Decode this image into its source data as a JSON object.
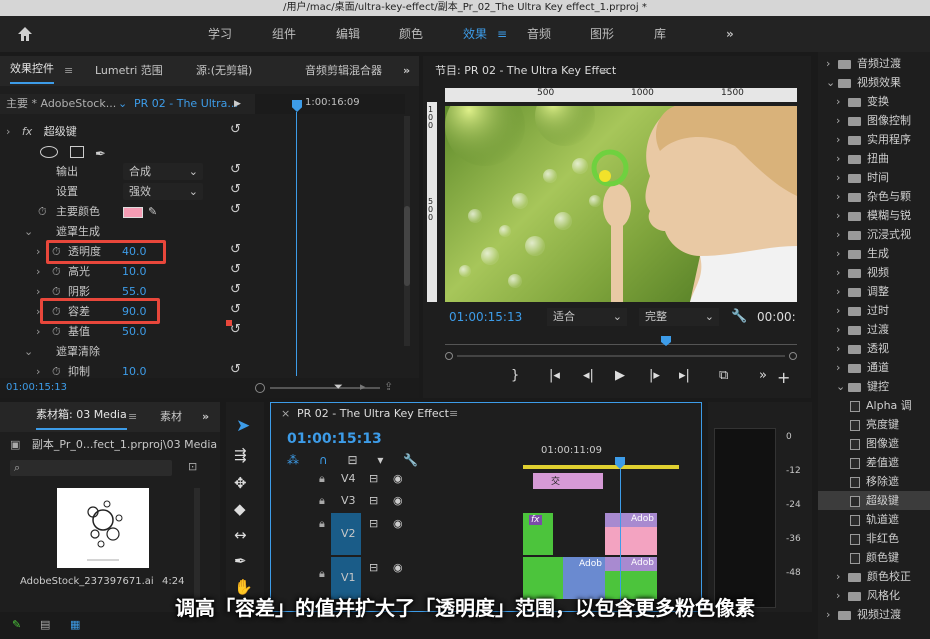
{
  "window_title": "/用户/mac/桌面/ultra-key-effect/副本_Pr_02_The Ultra Key effect_1.prproj *",
  "nav": {
    "items": [
      "学习",
      "组件",
      "编辑",
      "颜色",
      "效果",
      "音频",
      "图形",
      "库"
    ],
    "active": "效果",
    "more": "»"
  },
  "effect_controls": {
    "tabs": [
      "效果控件",
      "Lumetri 范围",
      "源:(无剪辑)",
      "音频剪辑混合器"
    ],
    "master_label": "主要 * AdobeStock...",
    "clip_label": "PR 02 - The Ultra...",
    "timecode_ruler": "1:00:16:09",
    "effect_name": "超级键",
    "rows": [
      {
        "label": "输出",
        "value": "合成"
      },
      {
        "label": "设置",
        "value": "强效"
      },
      {
        "label": "主要颜色",
        "value": ""
      },
      {
        "label": "遮罩生成",
        "value": ""
      },
      {
        "label": "透明度",
        "value": "40.0"
      },
      {
        "label": "高光",
        "value": "10.0"
      },
      {
        "label": "阴影",
        "value": "55.0"
      },
      {
        "label": "容差",
        "value": "90.0"
      },
      {
        "label": "基值",
        "value": "50.0"
      },
      {
        "label": "遮罩清除",
        "value": ""
      },
      {
        "label": "抑制",
        "value": "10.0"
      }
    ],
    "current_time": "01:00:15:13",
    "key_color": "#f59cb4"
  },
  "program": {
    "title": "节目: PR 02 - The Ultra Key Effect",
    "ruler_marks": [
      "500",
      "1000",
      "1500"
    ],
    "ruler_v_marks": [
      "100",
      "500"
    ],
    "timecode": "01:00:15:13",
    "fit": "适合",
    "quality": "完整",
    "duration": "00:00:"
  },
  "project": {
    "tabs": [
      "素材箱: 03 Media",
      "素材"
    ],
    "path": "副本_Pr_0...fect_1.prproj\\03 Media",
    "file_name": "AdobeStock_237397671.ai",
    "file_duration": "4:24"
  },
  "timeline": {
    "title": "PR 02 - The Ultra Key Effect",
    "timecode": "01:00:15:13",
    "ruler_time": "01:00:11:09",
    "tracks": [
      "V4",
      "V3",
      "V2",
      "V1"
    ],
    "clip_labels": [
      "fx",
      "交",
      "Adob",
      "Adob",
      "Adob"
    ]
  },
  "meters": {
    "labels": [
      "0",
      "-12",
      "-24",
      "-36",
      "-48"
    ]
  },
  "effects_tree": [
    {
      "label": "音频过渡",
      "level": 0,
      "type": "folder",
      "open": false
    },
    {
      "label": "视频效果",
      "level": 0,
      "type": "folder",
      "open": true
    },
    {
      "label": "变换",
      "level": 1,
      "type": "folder",
      "open": false
    },
    {
      "label": "图像控制",
      "level": 1,
      "type": "folder",
      "open": false
    },
    {
      "label": "实用程序",
      "level": 1,
      "type": "folder",
      "open": false
    },
    {
      "label": "扭曲",
      "level": 1,
      "type": "folder",
      "open": false
    },
    {
      "label": "时间",
      "level": 1,
      "type": "folder",
      "open": false
    },
    {
      "label": "杂色与颗",
      "level": 1,
      "type": "folder",
      "open": false
    },
    {
      "label": "模糊与锐",
      "level": 1,
      "type": "folder",
      "open": false
    },
    {
      "label": "沉浸式视",
      "level": 1,
      "type": "folder",
      "open": false
    },
    {
      "label": "生成",
      "level": 1,
      "type": "folder",
      "open": false
    },
    {
      "label": "视频",
      "level": 1,
      "type": "folder",
      "open": false
    },
    {
      "label": "调整",
      "level": 1,
      "type": "folder",
      "open": false
    },
    {
      "label": "过时",
      "level": 1,
      "type": "folder",
      "open": false
    },
    {
      "label": "过渡",
      "level": 1,
      "type": "folder",
      "open": false
    },
    {
      "label": "透视",
      "level": 1,
      "type": "folder",
      "open": false
    },
    {
      "label": "通道",
      "level": 1,
      "type": "folder",
      "open": false
    },
    {
      "label": "键控",
      "level": 1,
      "type": "folder",
      "open": true
    },
    {
      "label": "Alpha 调",
      "level": 2,
      "type": "effect"
    },
    {
      "label": "亮度键",
      "level": 2,
      "type": "effect"
    },
    {
      "label": "图像遮",
      "level": 2,
      "type": "effect"
    },
    {
      "label": "差值遮",
      "level": 2,
      "type": "effect"
    },
    {
      "label": "移除遮",
      "level": 2,
      "type": "effect"
    },
    {
      "label": "超级键",
      "level": 2,
      "type": "effect",
      "selected": true
    },
    {
      "label": "轨道遮",
      "level": 2,
      "type": "effect"
    },
    {
      "label": "非红色",
      "level": 2,
      "type": "effect"
    },
    {
      "label": "颜色键",
      "level": 2,
      "type": "effect"
    },
    {
      "label": "颜色校正",
      "level": 1,
      "type": "folder",
      "open": false
    },
    {
      "label": "风格化",
      "level": 1,
      "type": "folder",
      "open": false
    },
    {
      "label": "视频过渡",
      "level": 0,
      "type": "folder",
      "open": false
    }
  ],
  "caption": "调高「容差」的值并扩大了「透明度」范围，以包含更多粉色像素"
}
